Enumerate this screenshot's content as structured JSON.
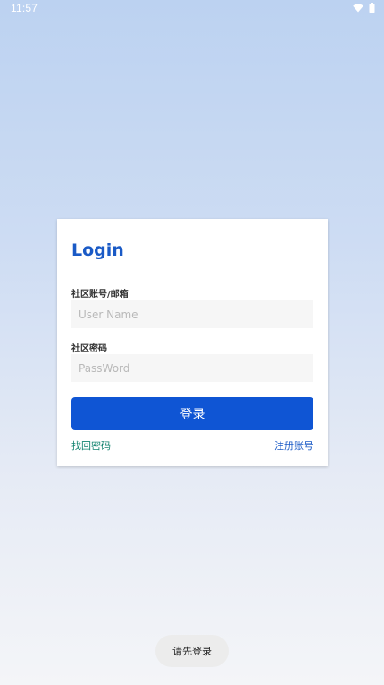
{
  "status_bar": {
    "time": "11:57",
    "icons": [
      "wifi-icon",
      "battery-icon"
    ]
  },
  "login": {
    "title": "Login",
    "username_label": "社区账号/邮箱",
    "username_placeholder": "User Name",
    "username_value": "",
    "password_label": "社区密码",
    "password_placeholder": "PassWord",
    "password_value": "",
    "submit_label": "登录",
    "forgot_password": "找回密码",
    "register": "注册账号"
  },
  "toast": {
    "message": "请先登录"
  },
  "colors": {
    "accent": "#0f55d4",
    "title": "#1a5ac6",
    "forgot_link": "#12836f",
    "register_link": "#1a5ac6"
  }
}
